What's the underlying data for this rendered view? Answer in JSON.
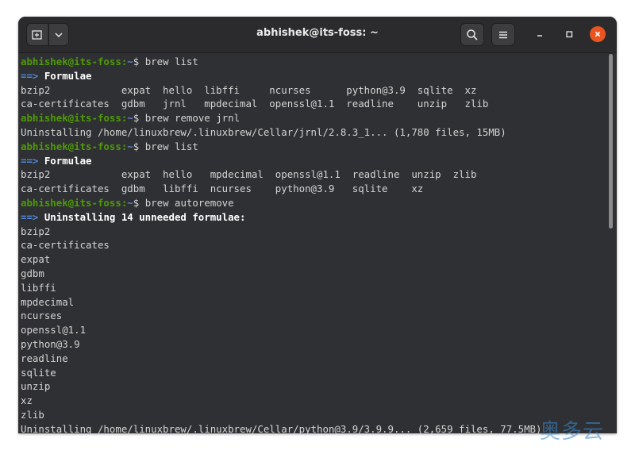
{
  "window": {
    "title": "abhishek@its-foss: ~"
  },
  "titlebar": {
    "new_tab_icon": "new-tab-icon",
    "menu_dropdown_icon": "chevron-down-icon",
    "search_icon": "search-icon",
    "menu_icon": "hamburger-icon",
    "minimize_icon": "minimize-icon",
    "maximize_icon": "maximize-icon",
    "close_icon": "close-icon"
  },
  "colors": {
    "prompt": "#4e9a06",
    "path": "#5f86c8",
    "arrow": "#4f88d8",
    "close": "#e95420",
    "background": "#2f3033"
  },
  "terminal": {
    "lines": [
      {
        "type": "prompt",
        "user": "abhishek@its-foss",
        "path": "~",
        "symbol": "$ ",
        "command": "brew list"
      },
      {
        "type": "heading",
        "arrow": "==> ",
        "text": "Formulae"
      },
      {
        "type": "output",
        "text": "bzip2            expat  hello  libffi     ncurses      python@3.9  sqlite  xz"
      },
      {
        "type": "output",
        "text": "ca-certificates  gdbm   jrnl   mpdecimal  openssl@1.1  readline    unzip   zlib"
      },
      {
        "type": "prompt",
        "user": "abhishek@its-foss",
        "path": "~",
        "symbol": "$ ",
        "command": "brew remove jrnl"
      },
      {
        "type": "output",
        "text": "Uninstalling /home/linuxbrew/.linuxbrew/Cellar/jrnl/2.8.3_1... (1,780 files, 15MB)"
      },
      {
        "type": "prompt",
        "user": "abhishek@its-foss",
        "path": "~",
        "symbol": "$ ",
        "command": "brew list"
      },
      {
        "type": "heading",
        "arrow": "==> ",
        "text": "Formulae"
      },
      {
        "type": "output",
        "text": "bzip2            expat  hello   mpdecimal  openssl@1.1  readline  unzip  zlib"
      },
      {
        "type": "output",
        "text": "ca-certificates  gdbm   libffi  ncurses    python@3.9   sqlite    xz"
      },
      {
        "type": "prompt",
        "user": "abhishek@its-foss",
        "path": "~",
        "symbol": "$ ",
        "command": "brew autoremove"
      },
      {
        "type": "heading",
        "arrow": "==> ",
        "text": "Uninstalling 14 unneeded formulae:"
      },
      {
        "type": "output",
        "text": "bzip2"
      },
      {
        "type": "output",
        "text": "ca-certificates"
      },
      {
        "type": "output",
        "text": "expat"
      },
      {
        "type": "output",
        "text": "gdbm"
      },
      {
        "type": "output",
        "text": "libffi"
      },
      {
        "type": "output",
        "text": "mpdecimal"
      },
      {
        "type": "output",
        "text": "ncurses"
      },
      {
        "type": "output",
        "text": "openssl@1.1"
      },
      {
        "type": "output",
        "text": "python@3.9"
      },
      {
        "type": "output",
        "text": "readline"
      },
      {
        "type": "output",
        "text": "sqlite"
      },
      {
        "type": "output",
        "text": "unzip"
      },
      {
        "type": "output",
        "text": "xz"
      },
      {
        "type": "output",
        "text": "zlib"
      },
      {
        "type": "output",
        "text": "Uninstalling /home/linuxbrew/.linuxbrew/Cellar/python@3.9/3.9.9... (2,659 files, 77.5MB)"
      }
    ]
  },
  "watermark": {
    "text": "奥多云"
  }
}
